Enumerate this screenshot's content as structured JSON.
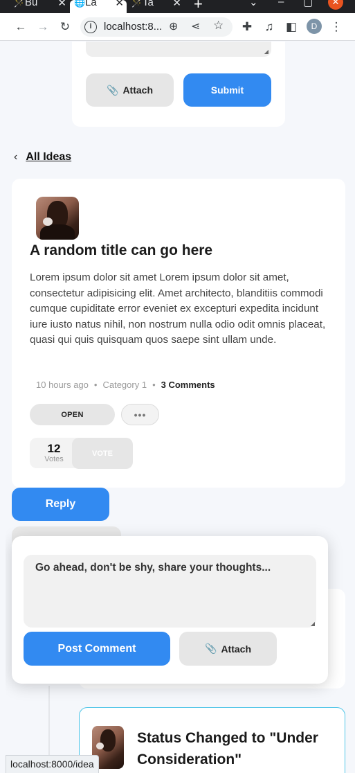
{
  "browser": {
    "tabs": [
      {
        "label": "Bu",
        "icon": "wand-icon"
      },
      {
        "label": "La",
        "icon": "globe-icon"
      },
      {
        "label": "Ta",
        "icon": "wand-icon"
      }
    ],
    "url": "localhost:8...",
    "profile_initial": "D"
  },
  "top_form": {
    "attach_label": "Attach",
    "submit_label": "Submit"
  },
  "nav": {
    "back_label": "All Ideas"
  },
  "idea": {
    "title": "A random title can go here",
    "body": "Lorem ipsum dolor sit amet Lorem ipsum dolor sit amet, consectetur adipisicing elit. Amet architecto, blanditiis commodi cumque cupiditate error eveniet ex excepturi expedita incidunt iure iusto natus nihil, non nostrum nulla odio odit omnis placeat, quasi qui quis quisquam quos saepe sint ullam unde.",
    "time": "10 hours ago",
    "category": "Category 1",
    "comments": "3 Comments",
    "status": "OPEN",
    "more": "•••",
    "votes_count": "12",
    "votes_label": "Votes",
    "vote_button": "VOTE"
  },
  "reply": {
    "reply_label": "Reply",
    "placeholder": "Go ahead, don't be shy, share your thoughts...",
    "post_label": "Post Comment",
    "attach_label": "Attach"
  },
  "status_card": {
    "title": "Status Changed to \"Under Consideration\""
  },
  "status_bar": {
    "link": "localhost:8000/idea"
  }
}
